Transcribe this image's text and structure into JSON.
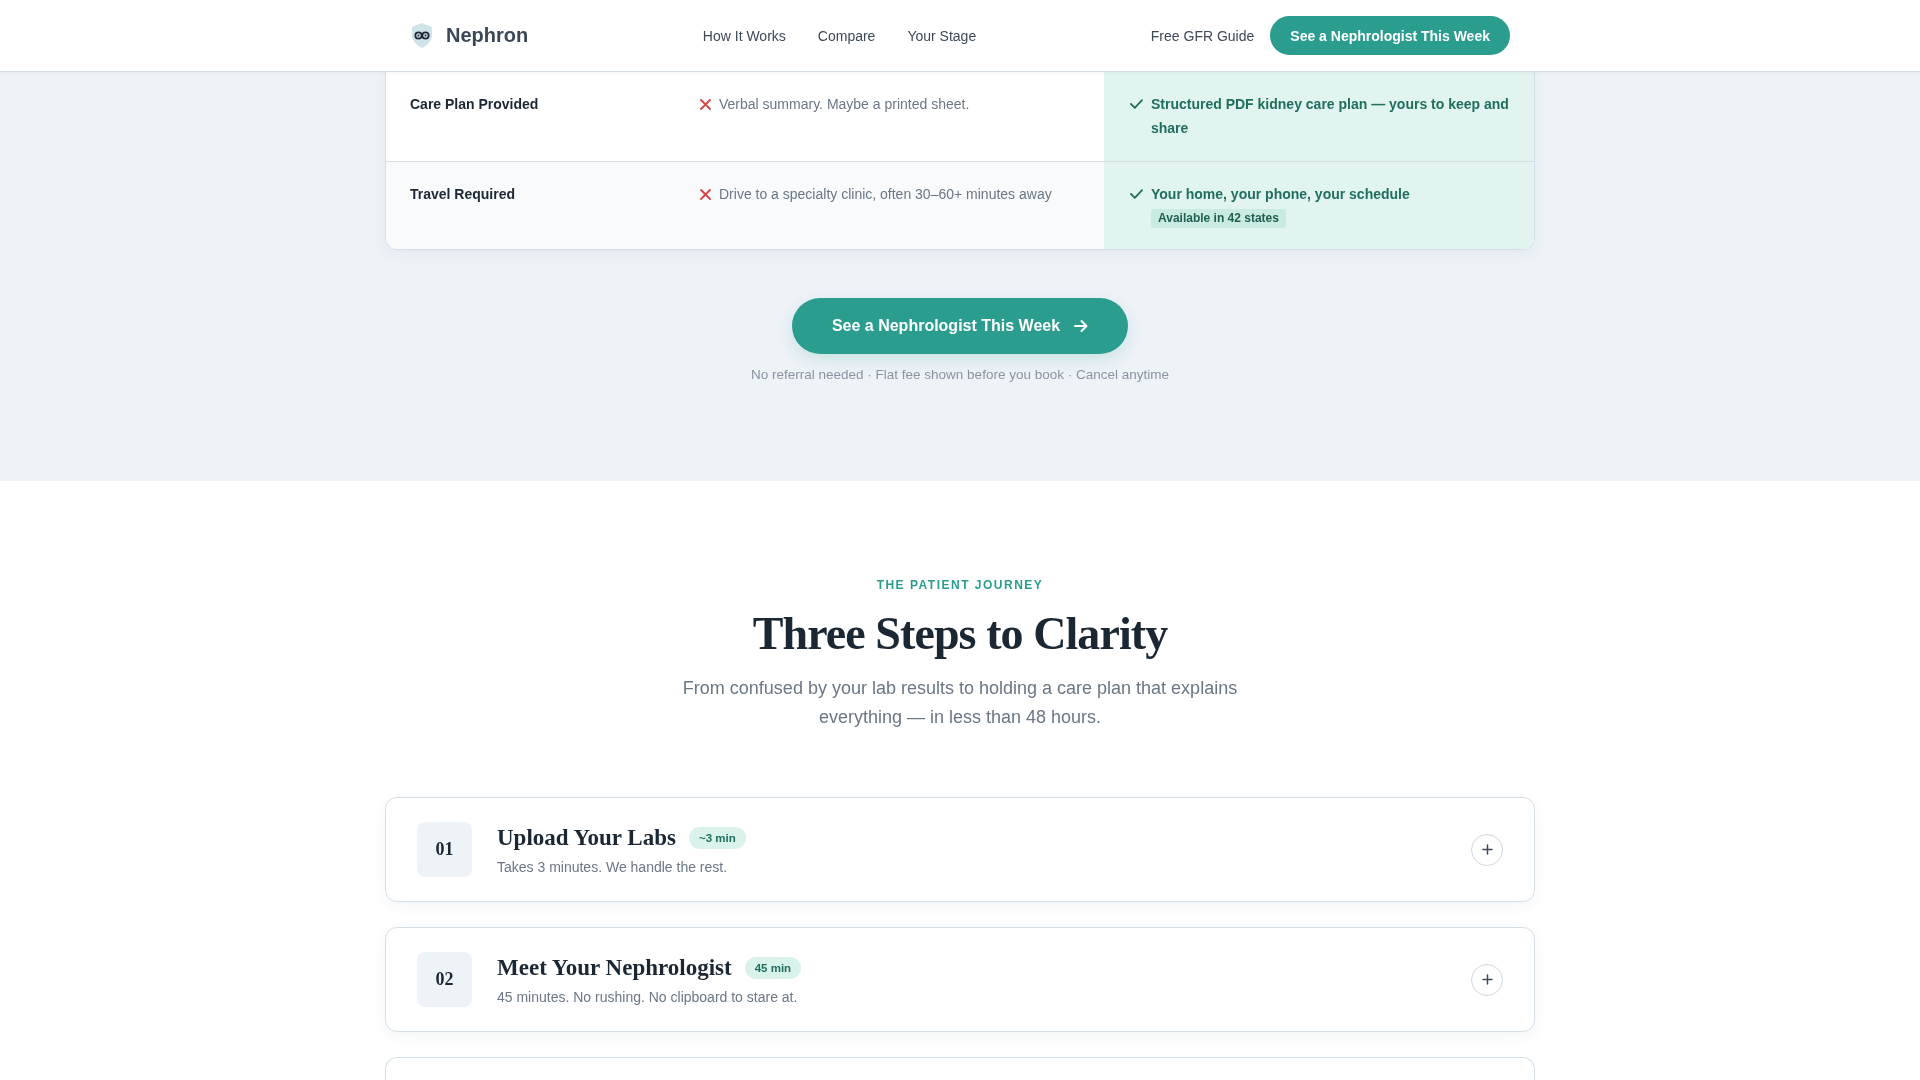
{
  "header": {
    "brand": "Nephron",
    "nav": [
      {
        "label": "How It Works"
      },
      {
        "label": "Compare"
      },
      {
        "label": "Your Stage"
      }
    ],
    "guide_link": "Free GFR Guide",
    "cta": "See a Nephrologist This Week"
  },
  "comparison": {
    "rows": [
      {
        "column_1": "Care Plan Provided",
        "column_2": "Verbal summary. Maybe a printed sheet.",
        "column_3": "Structured PDF kidney care plan — yours to keep and share"
      },
      {
        "column_1": "Travel Required",
        "column_2": "Drive to a specialty clinic, often 30–60+ minutes away",
        "column_3": "Your home, your phone, your schedule",
        "column_3_tag": "Available in 42 states"
      }
    ]
  },
  "cta": {
    "button": "See a Nephrologist This Week",
    "note": "No referral needed · Flat fee shown before you book · Cancel anytime"
  },
  "journey": {
    "eyebrow": "THE PATIENT JOURNEY",
    "title": "Three Steps to Clarity",
    "subtitle": "From confused by your lab results to holding a care plan that explains everything — in less than 48 hours.",
    "steps": [
      {
        "number": "01",
        "title": "Upload Your Labs",
        "duration": "~3 min",
        "summary": "Takes 3 minutes. We handle the rest.",
        "expanded": false
      },
      {
        "number": "02",
        "title": "Meet Your Nephrologist",
        "duration": "45 min",
        "summary": "45 minutes. No rushing. No clipboard to stare at.",
        "expanded": false
      }
    ]
  }
}
